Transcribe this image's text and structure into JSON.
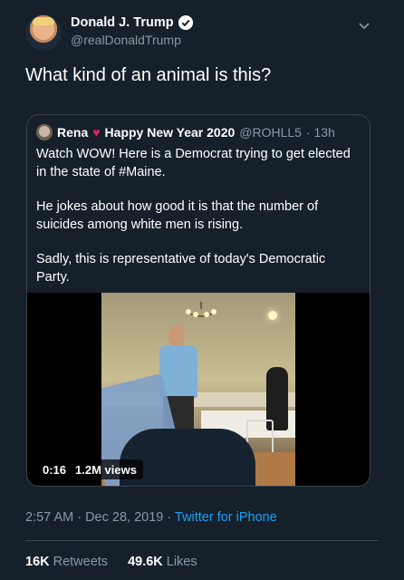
{
  "tweet": {
    "display_name": "Donald J. Trump",
    "handle": "@realDonaldTrump",
    "text": "What kind of an animal is this?"
  },
  "quoted": {
    "name_prefix": "Rena",
    "name_suffix": "Happy New Year 2020",
    "handle": "@ROHLL5",
    "time": "· 13h",
    "paragraphs": [
      "Watch WOW! Here is a Democrat trying to get elected in the state of #Maine.",
      "He jokes about how good it is that the number of suicides among white men is rising.",
      "Sadly, this is representative of today's Democratic Party."
    ],
    "video": {
      "duration": "0:16",
      "views": "1.2M views"
    }
  },
  "meta": {
    "time_date": "2:57 AM · Dec 28, 2019 · ",
    "source": "Twitter for iPhone"
  },
  "stats": {
    "retweets_count": "16K",
    "retweets_label": "Retweets",
    "likes_count": "49.6K",
    "likes_label": "Likes"
  },
  "icons": {
    "verified": "verified-badge-icon",
    "chevron": "chevron-down-icon",
    "heart": "red-heart-emoji"
  },
  "colors": {
    "background": "#15202b",
    "secondary_text": "#8899a6",
    "link": "#1da1f2",
    "border": "#38444d"
  }
}
